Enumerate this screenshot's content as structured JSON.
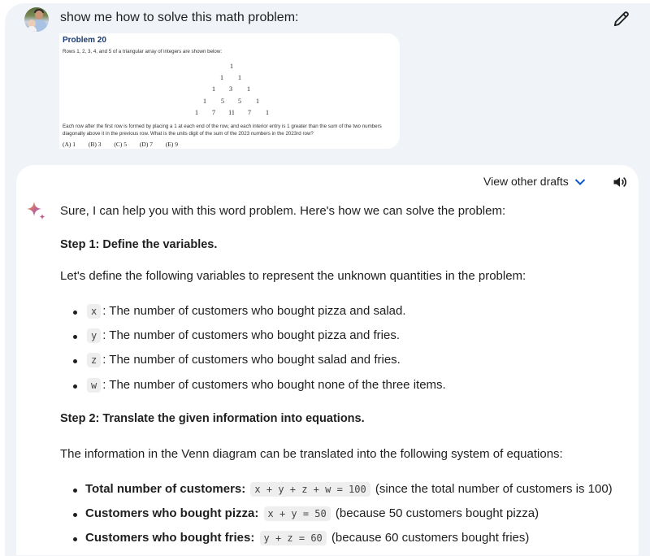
{
  "user_message": {
    "avatar": "user-avatar-photo",
    "text": "show me how to solve this math problem:",
    "edit_icon": "pencil-icon",
    "attachment": {
      "title": "Problem 20",
      "intro": "Rows 1, 2, 3, 4, and 5 of a triangular array of integers are shown below:",
      "rows": [
        [
          "1"
        ],
        [
          "1",
          "1"
        ],
        [
          "1",
          "3",
          "1"
        ],
        [
          "1",
          "5",
          "5",
          "1"
        ],
        [
          "1",
          "7",
          "11",
          "7",
          "1"
        ]
      ],
      "description": "Each row after the first row is formed by placing a 1 at each end of the row, and each interior entry is 1 greater than the sum of the two numbers diagonally above it in the previous row. What is the units digit of the sum of the 2023 numbers in the 2023rd row?",
      "choices": [
        "(A) 1",
        "(B) 3",
        "(C) 5",
        "(D) 7",
        "(E) 9"
      ]
    }
  },
  "response": {
    "view_drafts_label": "View other drafts",
    "chevron_icon": "chevron-down-icon",
    "speaker_icon": "speaker-icon",
    "sparkle_icon": "gemini-sparkle-icon",
    "intro": "Sure, I can help you with this word problem. Here's how we can solve the problem:",
    "step1_title": "Step 1: Define the variables.",
    "step1_text": "Let's define the following variables to represent the unknown quantities in the problem:",
    "variables": [
      {
        "var": "x",
        "desc": ": The number of customers who bought pizza and salad."
      },
      {
        "var": "y",
        "desc": ": The number of customers who bought pizza and fries."
      },
      {
        "var": "z",
        "desc": ": The number of customers who bought salad and fries."
      },
      {
        "var": "w",
        "desc": ": The number of customers who bought none of the three items."
      }
    ],
    "step2_title": "Step 2: Translate the given information into equations.",
    "step2_text": "The information in the Venn diagram can be translated into the following system of equations:",
    "equations": [
      {
        "label": "Total number of customers:",
        "eq": "x + y + z + w = 100",
        "note": "(since the total number of customers is 100)"
      },
      {
        "label": "Customers who bought pizza:",
        "eq": "x + y = 50",
        "note": "(because 50 customers bought pizza)"
      },
      {
        "label": "Customers who bought fries:",
        "eq": "y + z = 60",
        "note": "(because 60 customers bought fries)"
      }
    ]
  }
}
